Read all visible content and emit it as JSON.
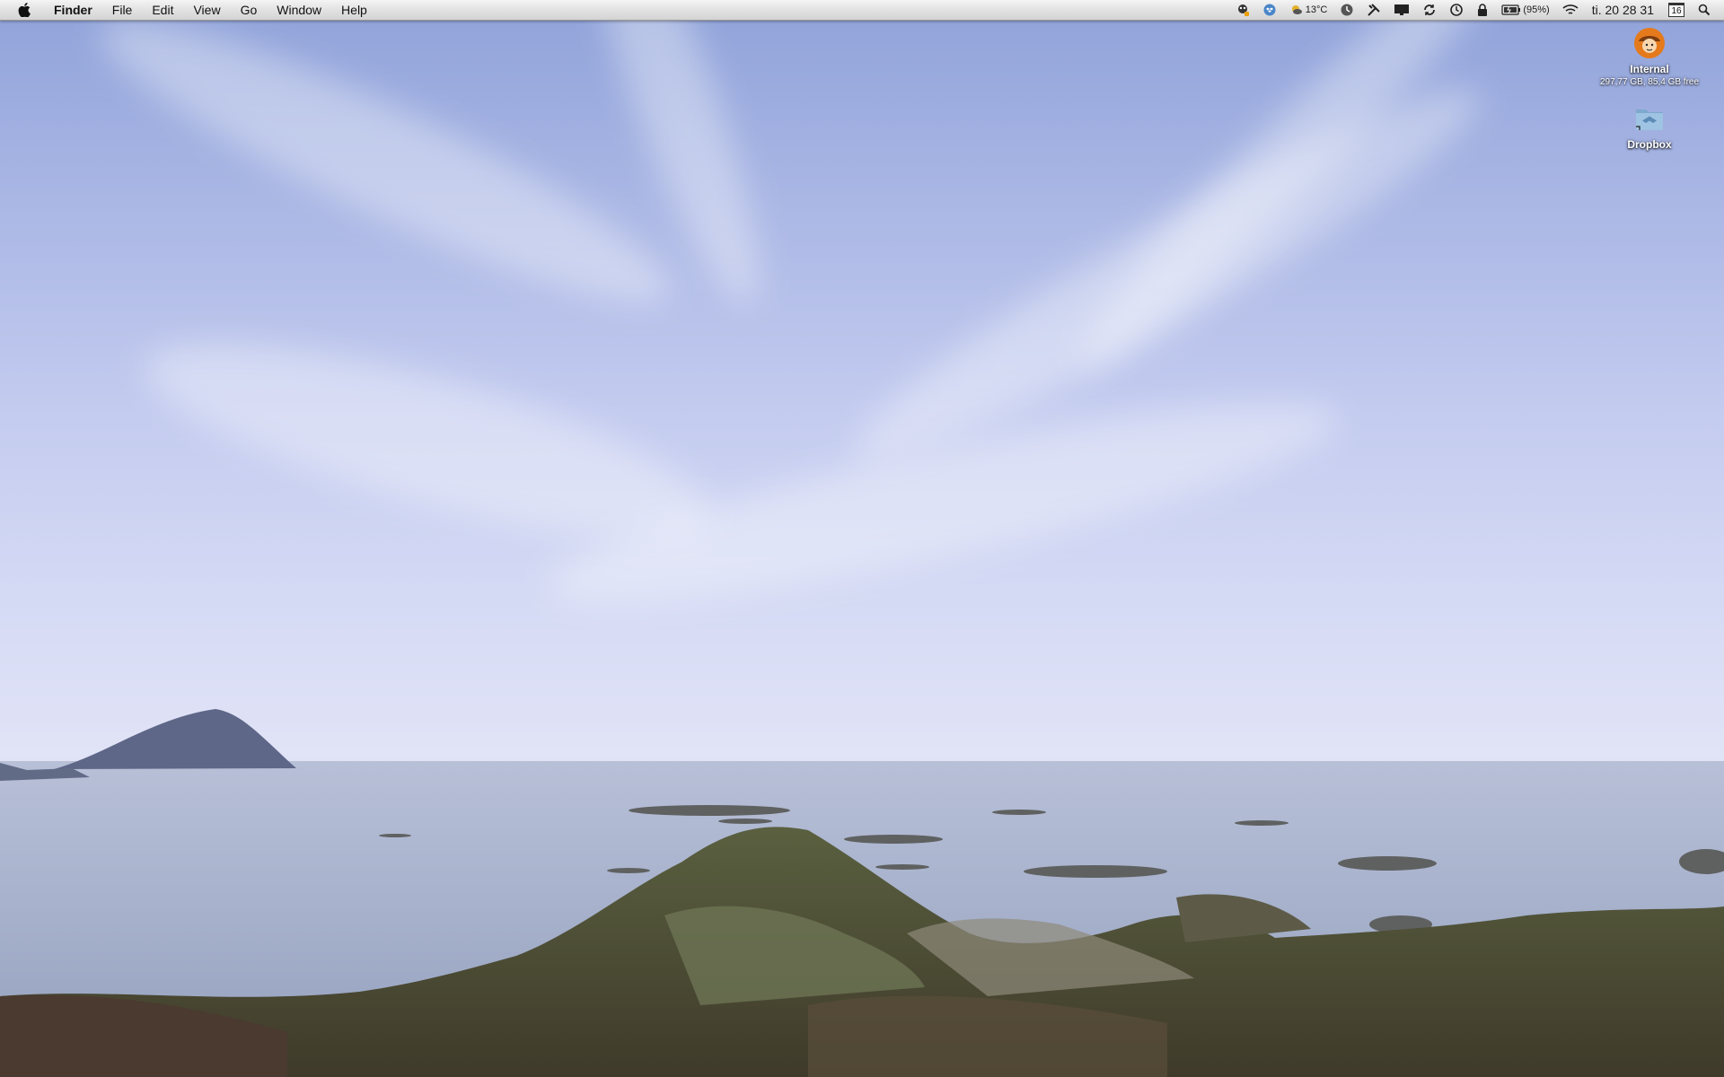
{
  "menubar": {
    "app_name": "Finder",
    "menus": [
      "File",
      "Edit",
      "View",
      "Go",
      "Window",
      "Help"
    ],
    "status": {
      "temperature": "13°C",
      "battery_percent": "(95%)",
      "clock": "ti. 20 28 31",
      "calendar_day": "16"
    }
  },
  "desktop": {
    "icons": [
      {
        "label": "Internal",
        "sub": "297,77 GB, 85,4 GB free",
        "icon": "hard-drive-user-icon"
      },
      {
        "label": "Dropbox",
        "icon": "dropbox-folder-icon"
      }
    ]
  },
  "colors": {
    "sky_top": "#8fa2d9",
    "sky_horizon": "#e1e3f6",
    "sea": "#aab4cf",
    "land": "#5b5a3c"
  }
}
